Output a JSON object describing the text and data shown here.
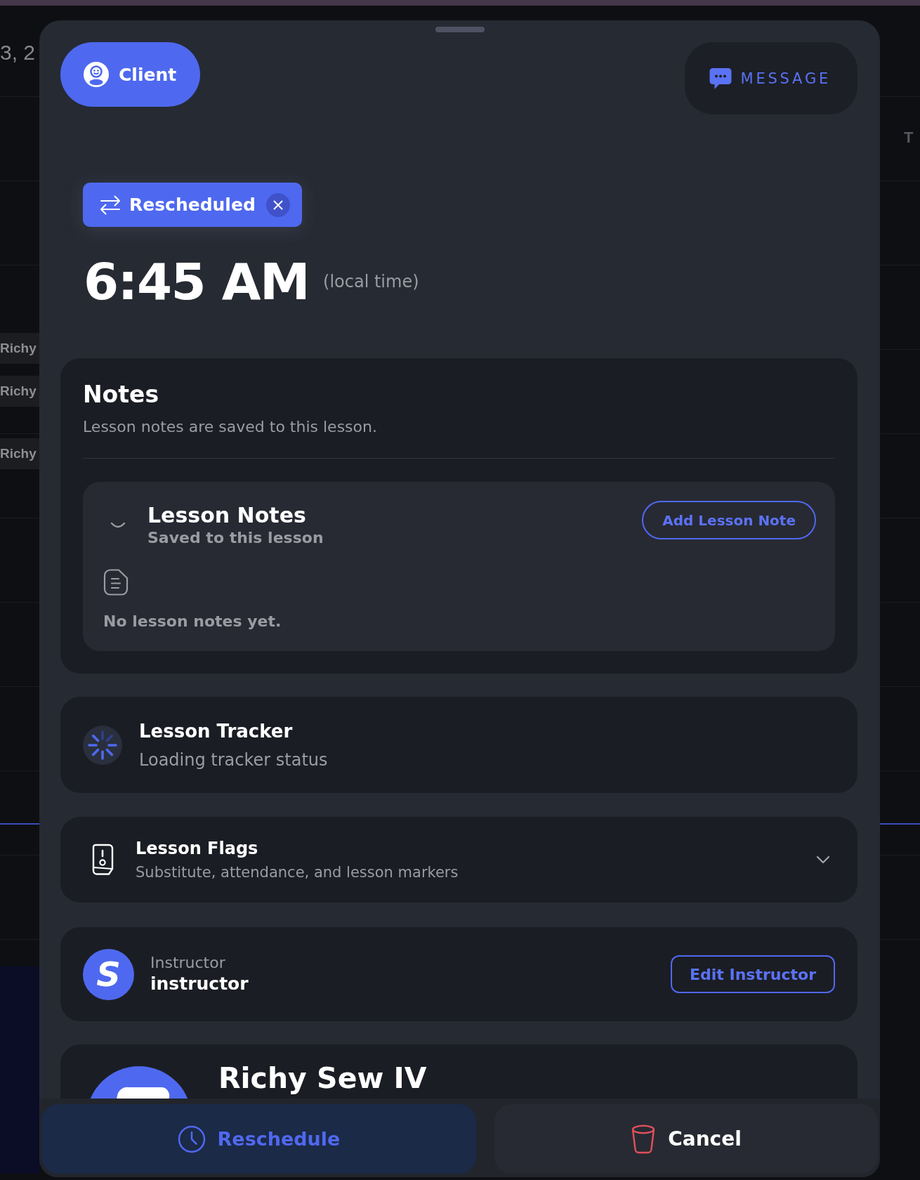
{
  "page_behind": {
    "date_fragment": "3, 2",
    "name_chips": [
      "Richy",
      "Richy",
      "Richy"
    ],
    "column_fragment": "T"
  },
  "sheet": {
    "role_button": {
      "label": "Client"
    },
    "message_button": {
      "label": "MESSAGE"
    },
    "status_chip": {
      "label": "Rescheduled"
    },
    "time": {
      "value": "6:45 AM",
      "note": "(local time)"
    },
    "notes": {
      "title": "Notes",
      "subtitle": "Lesson notes are saved to this lesson.",
      "lesson_notes": {
        "title": "Lesson Notes",
        "subtitle": "Saved to this lesson",
        "expanded": true,
        "add_button": "Add Lesson Note",
        "empty_text": "No lesson notes yet."
      }
    },
    "tracker": {
      "title": "Lesson Tracker",
      "status": "Loading tracker status",
      "loading": true
    },
    "flags": {
      "title": "Lesson Flags",
      "subtitle": "Substitute, attendance, and lesson markers",
      "expanded": false
    },
    "instructor": {
      "label": "Instructor",
      "name": "instructor",
      "avatar_letter": "S",
      "edit_button": "Edit Instructor"
    },
    "client_profile": {
      "name": "Richy Sew IV"
    }
  },
  "actions": [
    {
      "kind": "reschedule",
      "label": "Reschedule"
    },
    {
      "kind": "cancel",
      "label": "Cancel"
    }
  ]
}
